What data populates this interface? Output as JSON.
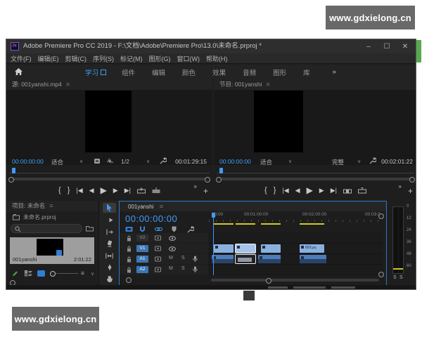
{
  "watermark": {
    "text": "www.gdxielong.cn"
  },
  "titlebar": {
    "logo": "Pr",
    "app_title": "Adobe Premiere Pro CC 2019 - F:\\文档\\Adobe\\Premiere Pro\\13.0\\未命名.prproj *",
    "minimize": "–",
    "maximize": "☐",
    "close": "✕"
  },
  "menubar": {
    "items": [
      "文件(F)",
      "编辑(E)",
      "剪辑(C)",
      "序列(S)",
      "标记(M)",
      "图形(G)",
      "窗口(W)",
      "帮助(H)"
    ]
  },
  "workspace": {
    "tabs": [
      "学习",
      "组件",
      "编辑",
      "颜色",
      "效果",
      "音频",
      "图形",
      "库"
    ],
    "overflow": "»"
  },
  "source_monitor": {
    "title": "源: 001yanshi.mp4",
    "menu_icon": "≡",
    "timecode": "00:00:00:00",
    "zoom_level": "适合",
    "caret": "∨",
    "playback_resolution": "1/2",
    "duration": "00:01:29:15"
  },
  "program_monitor": {
    "title": "节目: 001yanshi",
    "menu_icon": "≡",
    "timecode": "00:00:00:00",
    "zoom_level": "适合",
    "caret": "∨",
    "quality": "完整",
    "duration": "00:02:01:22"
  },
  "transport": {
    "mark_in": "{",
    "mark_out": "}",
    "go_to_in": "|◀",
    "step_back": "◀",
    "play": "▶",
    "step_forward": "▶",
    "go_to_out": "▶|",
    "more": "»",
    "add": "+"
  },
  "project_panel": {
    "title": "项目: 未命名",
    "menu_icon": "≡",
    "breadcrumb": "未命名.prproj",
    "item": {
      "name": "001yanshi",
      "duration": "2:01:22"
    },
    "menu2_icon": "≡",
    "caret": "∨"
  },
  "timeline": {
    "tab": "001yanshi",
    "menu_icon": "≡",
    "timecode": "00:00:00:00",
    "ruler_ticks": [
      "00:00",
      "00:01:00:00",
      "00:02:00:00",
      "00:03:0"
    ],
    "tracks": {
      "v2": "V2",
      "v1": "V1",
      "a1": "A1",
      "a2": "A2"
    },
    "mute": "M",
    "solo": "S",
    "clip4_label": "001ya."
  },
  "audio_meters": {
    "ticks": [
      "0",
      "12",
      "24",
      "36",
      "48",
      "60"
    ],
    "solo_left": "S",
    "solo_right": "S"
  }
}
